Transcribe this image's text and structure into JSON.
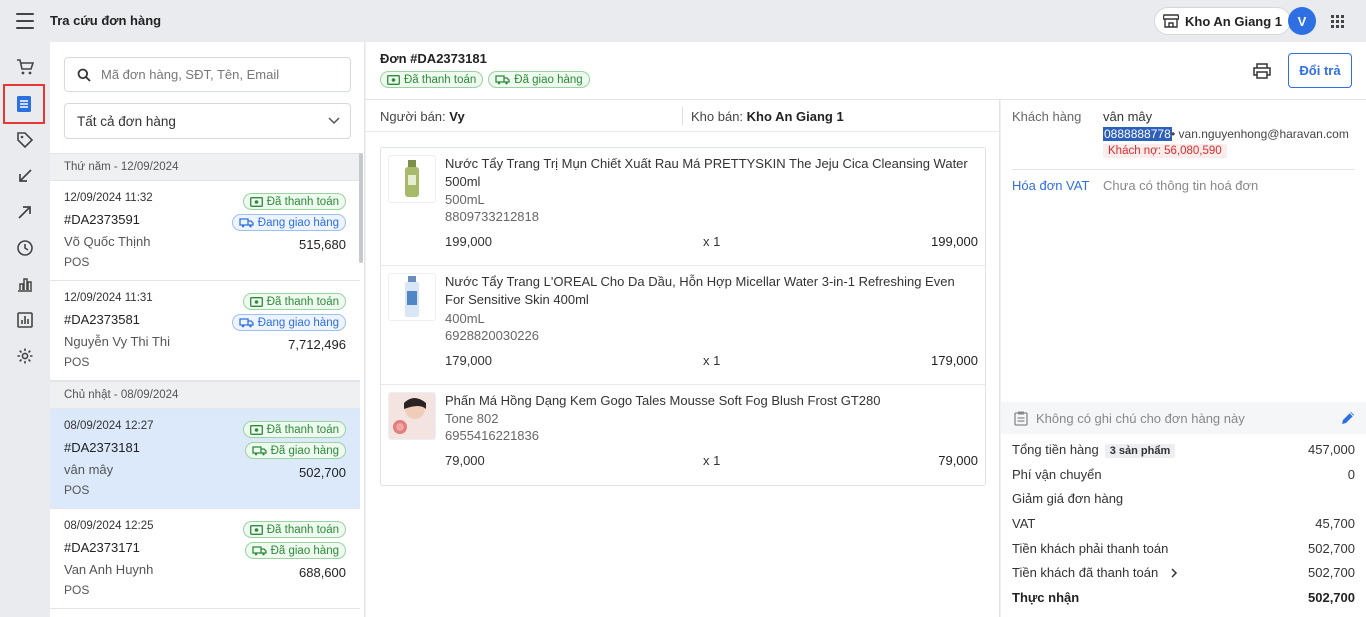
{
  "header": {
    "title": "Tra cứu đơn hàng",
    "store": "Kho An Giang 1",
    "avatar_letter": "V"
  },
  "rail": {
    "items": [
      "cart-icon",
      "orders-icon",
      "tag-icon",
      "inbound-icon",
      "outbound-icon",
      "clock-icon",
      "bar-chart-icon",
      "report-icon",
      "gear-icon"
    ],
    "active": "orders-icon"
  },
  "search": {
    "placeholder": "Mã đơn hàng, SĐT, Tên, Email",
    "value": ""
  },
  "filter": {
    "selected": "Tất cả đơn hàng"
  },
  "groups": [
    {
      "date": "Thứ năm - 12/09/2024"
    },
    {
      "date": "Chủ nhật - 08/09/2024"
    }
  ],
  "orders": [
    {
      "time": "12/09/2024 11:32",
      "code": "#DA2373591",
      "customer": "Võ Quốc Thịnh",
      "channel": "POS",
      "total": "515,680",
      "payment": "Đã thanh toán",
      "shipping": "Đang giao hàng"
    },
    {
      "time": "12/09/2024 11:31",
      "code": "#DA2373581",
      "customer": "Nguyễn Vy Thi Thi",
      "channel": "POS",
      "total": "7,712,496",
      "payment": "Đã thanh toán",
      "shipping": "Đang giao hàng"
    },
    {
      "time": "08/09/2024 12:27",
      "code": "#DA2373181",
      "customer": "vân mây",
      "channel": "POS",
      "total": "502,700",
      "payment": "Đã thanh toán",
      "shipping": "Đã giao hàng"
    },
    {
      "time": "08/09/2024 12:25",
      "code": "#DA2373171",
      "customer": "Van Anh Huynh",
      "channel": "POS",
      "total": "688,600",
      "payment": "Đã thanh toán",
      "shipping": "Đã giao hàng"
    }
  ],
  "detail": {
    "title": "Đơn #DA2373181",
    "payment": "Đã thanh toán",
    "shipping": "Đã giao hàng",
    "return_label": "Đổi trả",
    "seller_label": "Người bán:",
    "seller": "Vy",
    "warehouse_label": "Kho bán:",
    "warehouse": "Kho An Giang 1",
    "items": [
      {
        "name": "Nước Tẩy Trang Trị Mụn Chiết Xuất Rau Má PRETTYSKIN The Jeju Cica Cleansing Water 500ml",
        "variant": "500mL",
        "sku": "8809733212818",
        "price": "199,000",
        "qty": "x 1",
        "line_total": "199,000"
      },
      {
        "name": "Nước Tẩy Trang L'OREAL Cho Da Dầu, Hỗn Hợp Micellar Water 3-in-1 Refreshing Even For Sensitive Skin 400ml",
        "variant": "400mL",
        "sku": "6928820030226",
        "price": "179,000",
        "qty": "x 1",
        "line_total": "179,000"
      },
      {
        "name": "Phấn Má Hồng Dạng Kem Gogo Tales Mousse Soft Fog Blush Frost GT280",
        "variant": "Tone 802",
        "sku": "6955416221836",
        "price": "79,000",
        "qty": "x 1",
        "line_total": "79,000"
      }
    ]
  },
  "customer": {
    "label": "Khách hàng",
    "name": "vân mây",
    "phone": "0888888778",
    "email": "• van.nguyenhong@haravan.com",
    "debt": "Khách nợ: 56,080,590",
    "vat_label": "Hóa đơn VAT",
    "vat_value": "Chưa có thông tin hoá đơn"
  },
  "note": "Không có ghi chú cho đơn hàng này",
  "summary": {
    "subtotal_label": "Tổng tiền hàng",
    "subtotal_count": "3 sản phẩm",
    "subtotal": "457,000",
    "shipping_label": "Phí vận chuyển",
    "shipping": "0",
    "discount_label": "Giảm giá đơn hàng",
    "vat_label": "VAT",
    "vat": "45,700",
    "due_label": "Tiền khách phải thanh toán",
    "due": "502,700",
    "paid_label": "Tiền khách đã thanh toán",
    "paid": "502,700",
    "net_label": "Thực nhận",
    "net": "502,700"
  },
  "colors": {
    "primary": "#2f6fe4",
    "success": "#2e8b3a",
    "danger": "#d32f2f",
    "selected_row": "#dbe9fb"
  }
}
